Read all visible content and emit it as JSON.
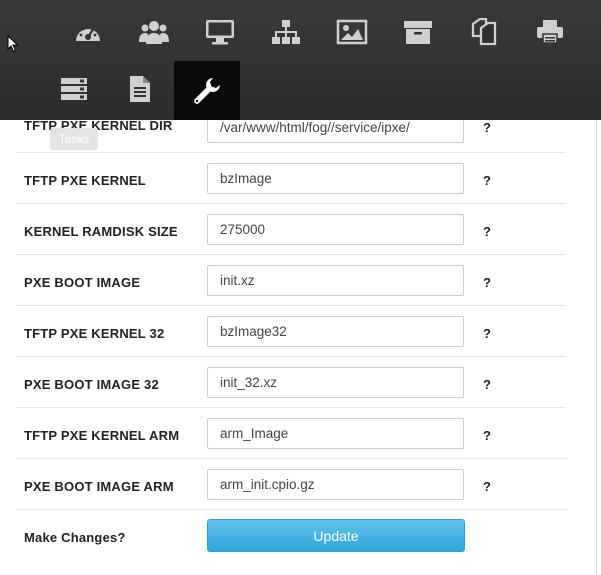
{
  "nav": {
    "row1": [
      {
        "icon": "dashboard-icon"
      },
      {
        "icon": "users-icon"
      },
      {
        "icon": "monitor-icon"
      },
      {
        "icon": "sitemap-icon"
      },
      {
        "icon": "image-icon"
      },
      {
        "icon": "archive-icon"
      },
      {
        "icon": "copy-icon"
      },
      {
        "icon": "printer-icon"
      }
    ],
    "row2": [
      {
        "icon": "list-icon"
      },
      {
        "icon": "document-icon"
      },
      {
        "icon": "wrench-icon",
        "active": true
      }
    ]
  },
  "tooltip": "Tasks",
  "settings": [
    {
      "label": "TFTP PXE KERNEL DIR",
      "value": "/var/www/html/fog//service/ipxe/",
      "help": "?"
    },
    {
      "label": "TFTP PXE KERNEL",
      "value": "bzImage",
      "help": "?"
    },
    {
      "label": "KERNEL RAMDISK SIZE",
      "value": "275000",
      "help": "?"
    },
    {
      "label": "PXE BOOT IMAGE",
      "value": "init.xz",
      "help": "?"
    },
    {
      "label": "TFTP PXE KERNEL 32",
      "value": "bzImage32",
      "help": "?"
    },
    {
      "label": "PXE BOOT IMAGE 32",
      "value": "init_32.xz",
      "help": "?"
    },
    {
      "label": "TFTP PXE KERNEL ARM",
      "value": "arm_Image",
      "help": "?"
    },
    {
      "label": "PXE BOOT IMAGE ARM",
      "value": "arm_init.cpio.gz",
      "help": "?"
    }
  ],
  "submit": {
    "label": "Make Changes?",
    "button": "Update"
  },
  "colors": {
    "nav_bg": "#333333",
    "nav_active": "#0b0b0b",
    "icon": "#d0d0d0",
    "button": "#3aaddd"
  }
}
